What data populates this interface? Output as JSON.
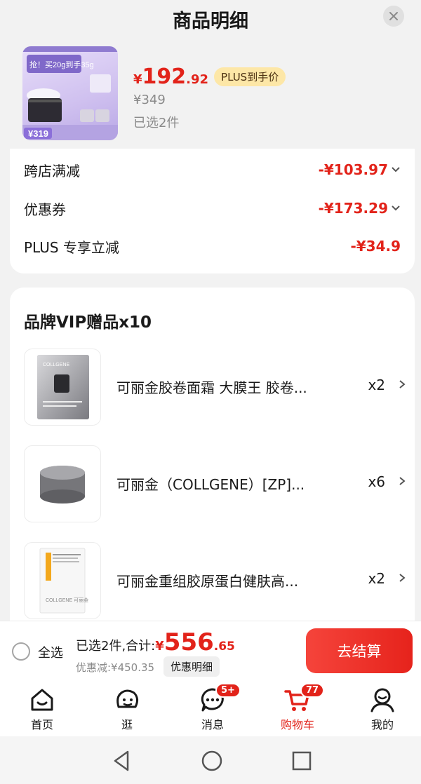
{
  "header": {
    "title": "商品明细"
  },
  "product": {
    "price_yen": "¥",
    "price_int": "192",
    "price_dec": ".92",
    "plus_tag": "PLUS到手价",
    "original_price": "¥349",
    "selected_count": "已选2件",
    "image_promo": "抢！买20g到手35g",
    "image_price": "319"
  },
  "discounts": [
    {
      "label": "跨店满减",
      "value": "-¥103.97",
      "expandable": true
    },
    {
      "label": "优惠券",
      "value": "-¥173.29",
      "expandable": true
    },
    {
      "label": "PLUS 专享立减",
      "value": "-¥34.9",
      "expandable": false
    }
  ],
  "gifts": {
    "title": "品牌VIP赠品x10",
    "items": [
      {
        "name": "可丽金胶卷面霜 大膜王 胶卷...",
        "qty": "x2",
        "thumb_text": "COLLGENE"
      },
      {
        "name": "可丽金（COLLGENE）[ZP]...",
        "qty": "x6",
        "thumb_text": ""
      },
      {
        "name": "可丽金重组胶原蛋白健肤高...",
        "qty": "x2",
        "thumb_text": "COLLGENE 可丽金"
      }
    ]
  },
  "checkout": {
    "select_all": "全选",
    "total_label": "已选2件,合计:",
    "total_yen": "¥",
    "total_int": "556",
    "total_dec": ".65",
    "saved": "优惠减:¥450.35",
    "detail_button": "优惠明细",
    "pay_button": "去结算"
  },
  "tabbar": [
    {
      "label": "首页",
      "icon": "home-icon",
      "badge": ""
    },
    {
      "label": "逛",
      "icon": "explore-icon",
      "badge": ""
    },
    {
      "label": "消息",
      "icon": "message-icon",
      "badge": "5+"
    },
    {
      "label": "购物车",
      "icon": "cart-icon",
      "badge": "77"
    },
    {
      "label": "我的",
      "icon": "profile-icon",
      "badge": ""
    }
  ],
  "colors": {
    "accent": "#e2231a",
    "plus_tag_bg": "#fde7a7"
  }
}
